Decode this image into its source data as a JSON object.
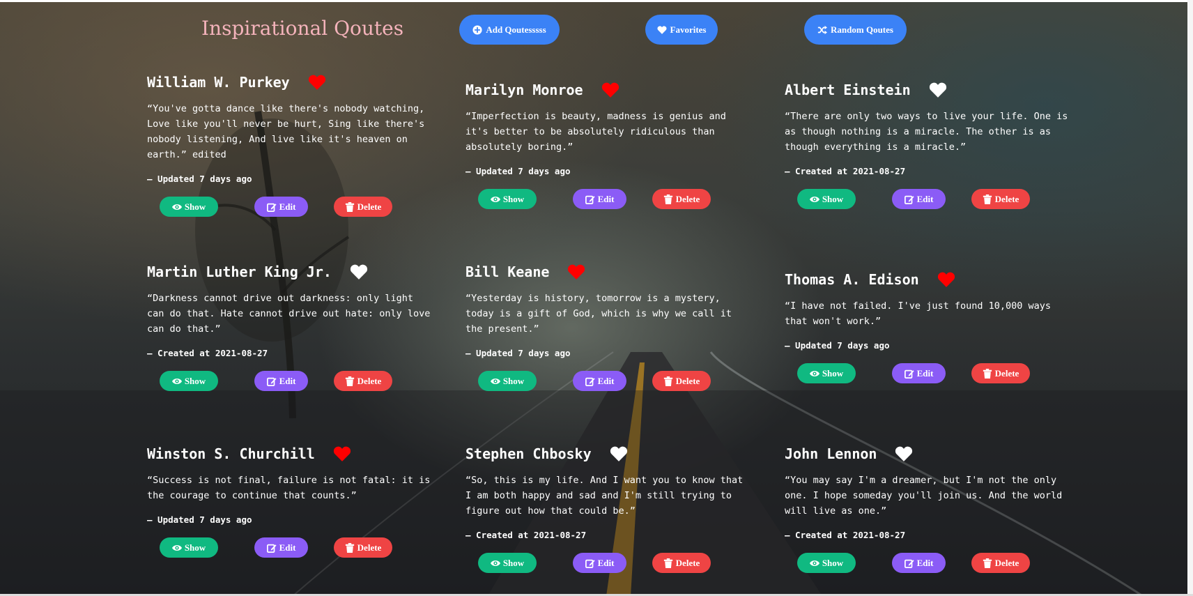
{
  "header": {
    "title": "Inspirational Qoutes",
    "nav": [
      {
        "label": "Add Qoutesssss",
        "icon": "plus-circle-icon"
      },
      {
        "label": "Favorites",
        "icon": "heart-icon"
      },
      {
        "label": "Random Qoutes",
        "icon": "shuffle-icon"
      }
    ]
  },
  "colors": {
    "title": "#f4b3bb",
    "nav_button": "#3b82f6",
    "show_button": "#10b981",
    "edit_button": "#8b5cf6",
    "delete_button": "#ef4444",
    "heart_favorite": "#ff0000",
    "heart_default": "#ffffff"
  },
  "labels": {
    "show": "Show",
    "edit": "Edit",
    "delete": "Delete"
  },
  "quotes": [
    {
      "author": "William W. Purkey",
      "favorite": true,
      "text": "“You've gotta dance like there's nobody watching,\nLove like you'll never be hurt, Sing like there's\nnobody listening, And live like it's heaven on\nearth.” edited",
      "meta": "— Updated 7 days ago"
    },
    {
      "author": "Marilyn Monroe",
      "favorite": true,
      "text": "“Imperfection is beauty, madness is genius and\nit's better to be absolutely ridiculous than\nabsolutely boring.”",
      "meta": "— Updated 7 days ago"
    },
    {
      "author": "Albert Einstein",
      "favorite": false,
      "text": "“There are only two ways to live your life. One is\nas though nothing is a miracle. The other is as\nthough everything is a miracle.”",
      "meta": "— Created at 2021-08-27"
    },
    {
      "author": "Martin Luther King Jr.",
      "favorite": false,
      "text": "“Darkness cannot drive out darkness: only light\ncan do that. Hate cannot drive out hate: only love\ncan do that.”",
      "meta": "— Created at 2021-08-27"
    },
    {
      "author": "Bill Keane",
      "favorite": true,
      "text": "“Yesterday is history, tomorrow is a mystery,\ntoday is a gift of God, which is why we call it\nthe present.”",
      "meta": "— Updated 7 days ago"
    },
    {
      "author": "Thomas A. Edison",
      "favorite": true,
      "text": "“I have not failed. I've just found 10,000 ways\nthat won't work.”",
      "meta": "— Updated 7 days ago"
    },
    {
      "author": "Winston S. Churchill",
      "favorite": true,
      "text": "“Success is not final, failure is not fatal: it is\nthe courage to continue that counts.”",
      "meta": "— Updated 7 days ago"
    },
    {
      "author": "Stephen Chbosky",
      "favorite": false,
      "text": "“So, this is my life. And I want you to know that\nI am both happy and sad and I'm still trying to\nfigure out how that could be.”",
      "meta": "— Created at 2021-08-27"
    },
    {
      "author": "John Lennon",
      "favorite": false,
      "text": "“You may say I'm a dreamer, but I'm not the only\none. I hope someday you'll join us. And the world\nwill live as one.”",
      "meta": "— Created at 2021-08-27"
    }
  ]
}
